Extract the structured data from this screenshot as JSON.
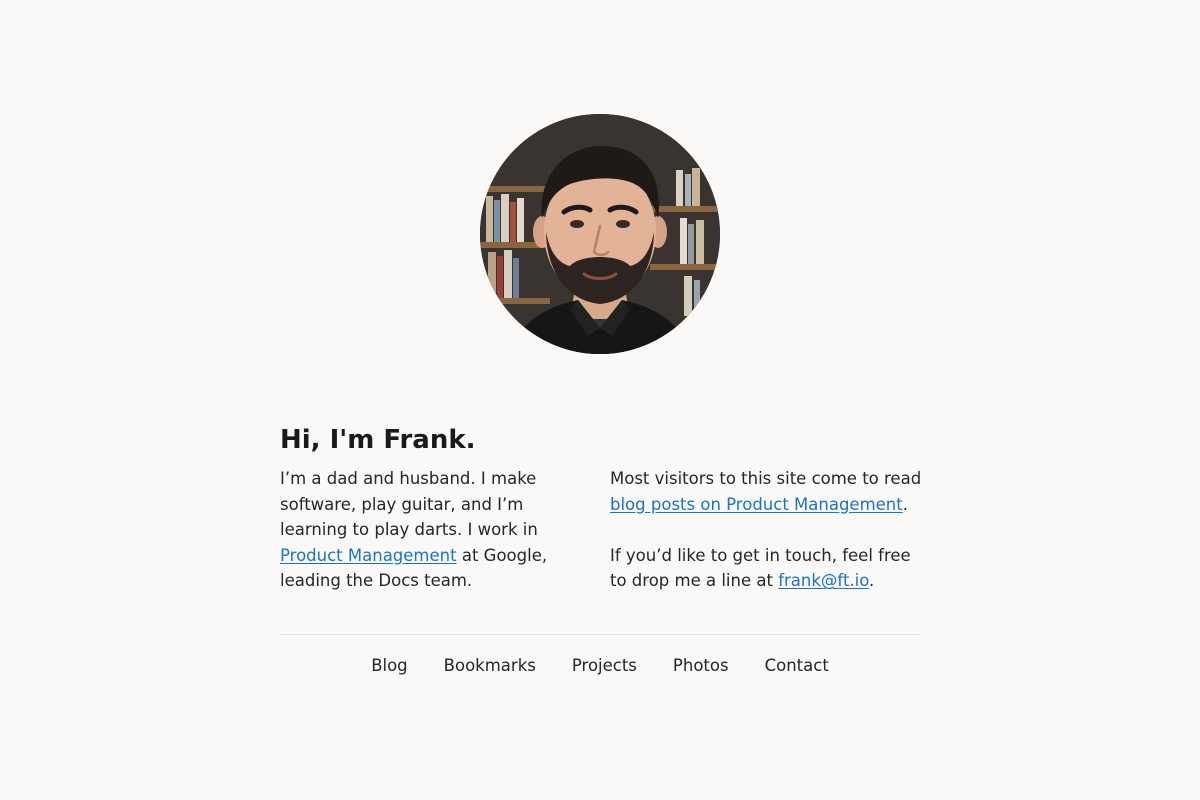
{
  "profile": {
    "avatar_alt": "Portrait photo",
    "heading": "Hi, I'm Frank."
  },
  "intro_left": {
    "text_before": "I’m a dad and husband. I make software, play guitar, and I’m learning to play darts. I work in ",
    "link_text": "Product Management",
    "text_after": " at Google, leading the Docs team."
  },
  "intro_right": {
    "p1_before": "Most visitors to this site come to read ",
    "p1_link": "blog posts on Product Management",
    "p1_after": ".",
    "p2_before": "If you’d like to get in touch, feel free to drop me a line at ",
    "p2_link": "frank@ft.io",
    "p2_after": "."
  },
  "nav": {
    "items": [
      {
        "label": "Blog"
      },
      {
        "label": "Bookmarks"
      },
      {
        "label": "Projects"
      },
      {
        "label": "Photos"
      },
      {
        "label": "Contact"
      }
    ]
  },
  "colors": {
    "background": "#faf9f7",
    "link": "#1a73c8",
    "text": "#262626"
  }
}
